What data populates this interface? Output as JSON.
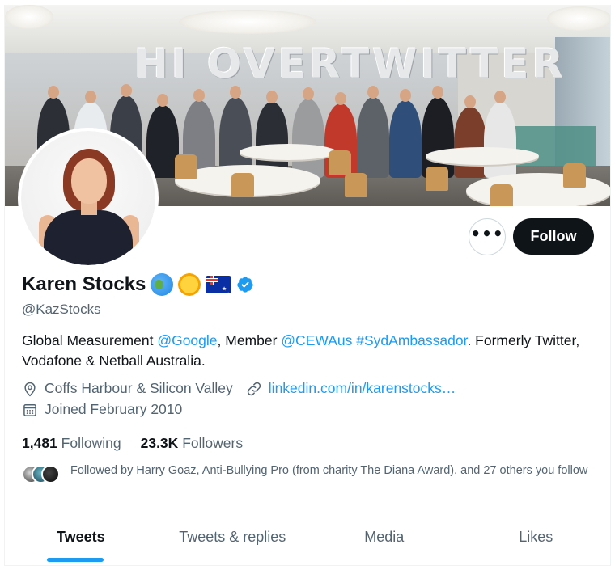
{
  "profile": {
    "display_name": "Karen Stocks",
    "handle": "@KazStocks",
    "banner_text": "HI OVERTWITTER",
    "emojis": [
      "globe-emoji",
      "sun-emoji",
      "australia-flag-emoji"
    ],
    "verified": true
  },
  "actions": {
    "more_label": "•••",
    "follow_label": "Follow"
  },
  "bio": {
    "part1": "Global Measurement ",
    "mention_google": "@Google",
    "part2": ", Member ",
    "mention_cewaus": "@CEWAus",
    "part3": " ",
    "hashtag": "#SydAmbassador",
    "part4": ". Formerly Twitter, Vodafone & Netball Australia."
  },
  "meta": {
    "location": "Coffs Harbour & Silicon Valley",
    "website": "linkedin.com/in/karenstocks…",
    "joined": "Joined February 2010"
  },
  "stats": {
    "following_count": "1,481",
    "following_label": "Following",
    "followers_count": "23.3K",
    "followers_label": "Followers"
  },
  "followed_by": {
    "text": "Followed by Harry Goaz, Anti-Bullying Pro (from charity The Diana Award), and 27 others you follow"
  },
  "tabs": [
    {
      "label": "Tweets",
      "active": true
    },
    {
      "label": "Tweets & replies",
      "active": false
    },
    {
      "label": "Media",
      "active": false
    },
    {
      "label": "Likes",
      "active": false
    }
  ],
  "colors": {
    "accent": "#1d9bf0",
    "text_primary": "#0f1419",
    "text_secondary": "#536471",
    "follow_button_bg": "#0f1419",
    "border": "#cfd9de"
  }
}
